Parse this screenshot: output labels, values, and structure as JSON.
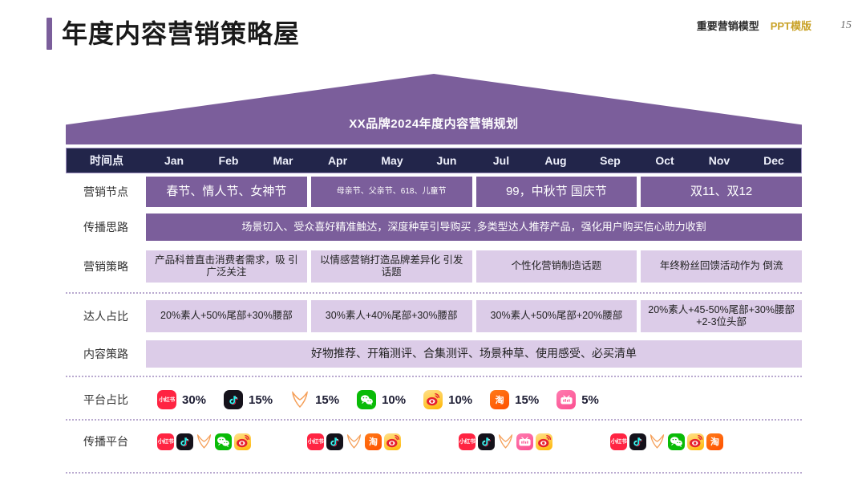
{
  "header": {
    "page_title": "年度内容营销策略屋",
    "brand_label": "重要营销模型",
    "ppt_label": "PPT模版",
    "page_number": "15",
    "accent_color": "#7B5E9B",
    "gold_color": "#C9A227"
  },
  "roof": {
    "title": "XX品牌2024年度内容营销规划",
    "color": "#7B5E9B"
  },
  "month_header": {
    "label": "时间点",
    "months": [
      "Jan",
      "Feb",
      "Mar",
      "Apr",
      "May",
      "Jun",
      "Jul",
      "Aug",
      "Sep",
      "Oct",
      "Nov",
      "Dec"
    ],
    "background": "#22254A"
  },
  "rows": {
    "jiedian": {
      "label": "营销节点",
      "cells": [
        "春节、情人节、女神节",
        "母亲节、父亲节、618、儿童节",
        "99，中秋节 国庆节",
        "双11、双12"
      ]
    },
    "sibu": {
      "label": "传播思路",
      "cells": [
        "场景切入、受众喜好精准触达，深度种草引导购买 ,多类型达人推荐产品，强化用户购买信心助力收割"
      ]
    },
    "celue": {
      "label": "营销策略",
      "cells": [
        "产品科普直击消费者需求，吸 引广泛关注",
        "以情感营销打造品牌差异化 引发话题",
        "个性化营销制造话题",
        "年终粉丝回馈活动作为 倒流"
      ]
    },
    "daren": {
      "label": "达人占比",
      "cells": [
        "20%素人+50%尾部+30%腰部",
        "30%素人+40%尾部+30%腰部",
        "30%素人+50%尾部+20%腰部",
        "20%素人+45-50%尾部+30%腰部+2-3位头部"
      ]
    },
    "neirong": {
      "label": "内容策路",
      "cells": [
        "好物推荐、开箱测评、合集测评、场景种草、使用感受、必买清单"
      ]
    },
    "pingtai_share": {
      "label": "平台占比",
      "items": [
        {
          "icon": "xiaohongshu-icon",
          "percent": "30%"
        },
        {
          "icon": "douyin-icon",
          "percent": "15%"
        },
        {
          "icon": "zhihu-icon",
          "percent": "15%"
        },
        {
          "icon": "wechat-icon",
          "percent": "10%"
        },
        {
          "icon": "weibo-icon",
          "percent": "10%"
        },
        {
          "icon": "taobao-icon",
          "percent": "15%"
        },
        {
          "icon": "bilibili-icon",
          "percent": "5%"
        }
      ]
    },
    "pingtai_logos": {
      "label": "传播平台",
      "groups": [
        [
          "xiaohongshu-icon",
          "douyin-icon",
          "zhihu-icon",
          "wechat-icon",
          "weibo-icon"
        ],
        [
          "xiaohongshu-icon",
          "douyin-icon",
          "zhihu-icon",
          "taobao-icon",
          "weibo-icon"
        ],
        [
          "xiaohongshu-icon",
          "douyin-icon",
          "zhihu-icon",
          "bilibili-icon",
          "weibo-icon"
        ],
        [
          "xiaohongshu-icon",
          "douyin-icon",
          "zhihu-icon",
          "wechat-icon",
          "weibo-icon",
          "taobao-icon"
        ]
      ]
    }
  },
  "icon_text": {
    "xiaohongshu": "小红书",
    "taobao": "淘"
  }
}
